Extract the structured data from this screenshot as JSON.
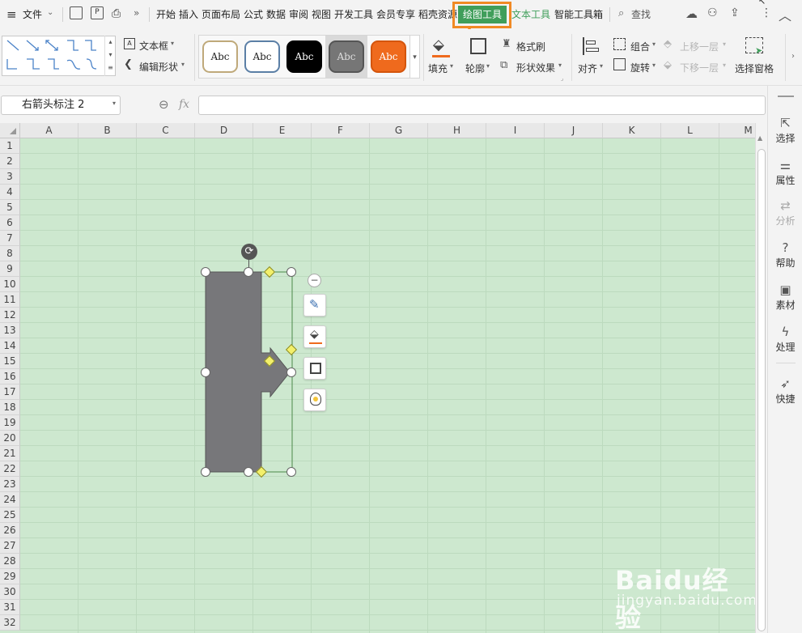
{
  "menubar": {
    "file_label": "文件",
    "tabs": [
      "开始",
      "插入",
      "页面布局",
      "公式",
      "数据",
      "审阅",
      "视图",
      "开发工具",
      "会员专享",
      "稻壳资源",
      "绘图工具",
      "文本工具",
      "智能工具箱"
    ],
    "search_label": "查找"
  },
  "ribbon": {
    "textbox_label": "文本框",
    "edit_shape_label": "编辑形状",
    "style_samples": [
      "Abc",
      "Abc",
      "Abc",
      "Abc",
      "Abc"
    ],
    "fill_label": "填充",
    "outline_label": "轮廓",
    "format_painter_label": "格式刷",
    "shape_effects_label": "形状效果",
    "align_label": "对齐",
    "group_label": "组合",
    "rotate_label": "旋转",
    "bring_forward_label": "上移一层",
    "send_backward_label": "下移一层",
    "selection_pane_label": "选择窗格"
  },
  "formula_bar": {
    "name_box_value": "右箭头标注 2",
    "fx_label": "fx",
    "formula_value": ""
  },
  "sheet": {
    "columns": [
      "A",
      "B",
      "C",
      "D",
      "E",
      "F",
      "G",
      "H",
      "I",
      "J",
      "K",
      "L",
      "M"
    ],
    "rows": [
      "1",
      "2",
      "3",
      "4",
      "5",
      "6",
      "7",
      "8",
      "9",
      "10",
      "11",
      "12",
      "13",
      "14",
      "15",
      "16",
      "17",
      "18",
      "19",
      "20",
      "21",
      "22",
      "23",
      "24",
      "25",
      "26",
      "27",
      "28",
      "29",
      "30",
      "31",
      "32"
    ]
  },
  "side_panel": {
    "items": [
      "选择",
      "属性",
      "分析",
      "帮助",
      "素材",
      "处理",
      "快捷"
    ]
  },
  "watermark": {
    "brand": "Baidu经验",
    "url": "jingyan.baidu.com"
  },
  "colors": {
    "accent_green": "#3f9e5a",
    "highlight_orange": "#f08a24",
    "grid_background": "#cde8cf",
    "shape_fill": "#77777a"
  }
}
